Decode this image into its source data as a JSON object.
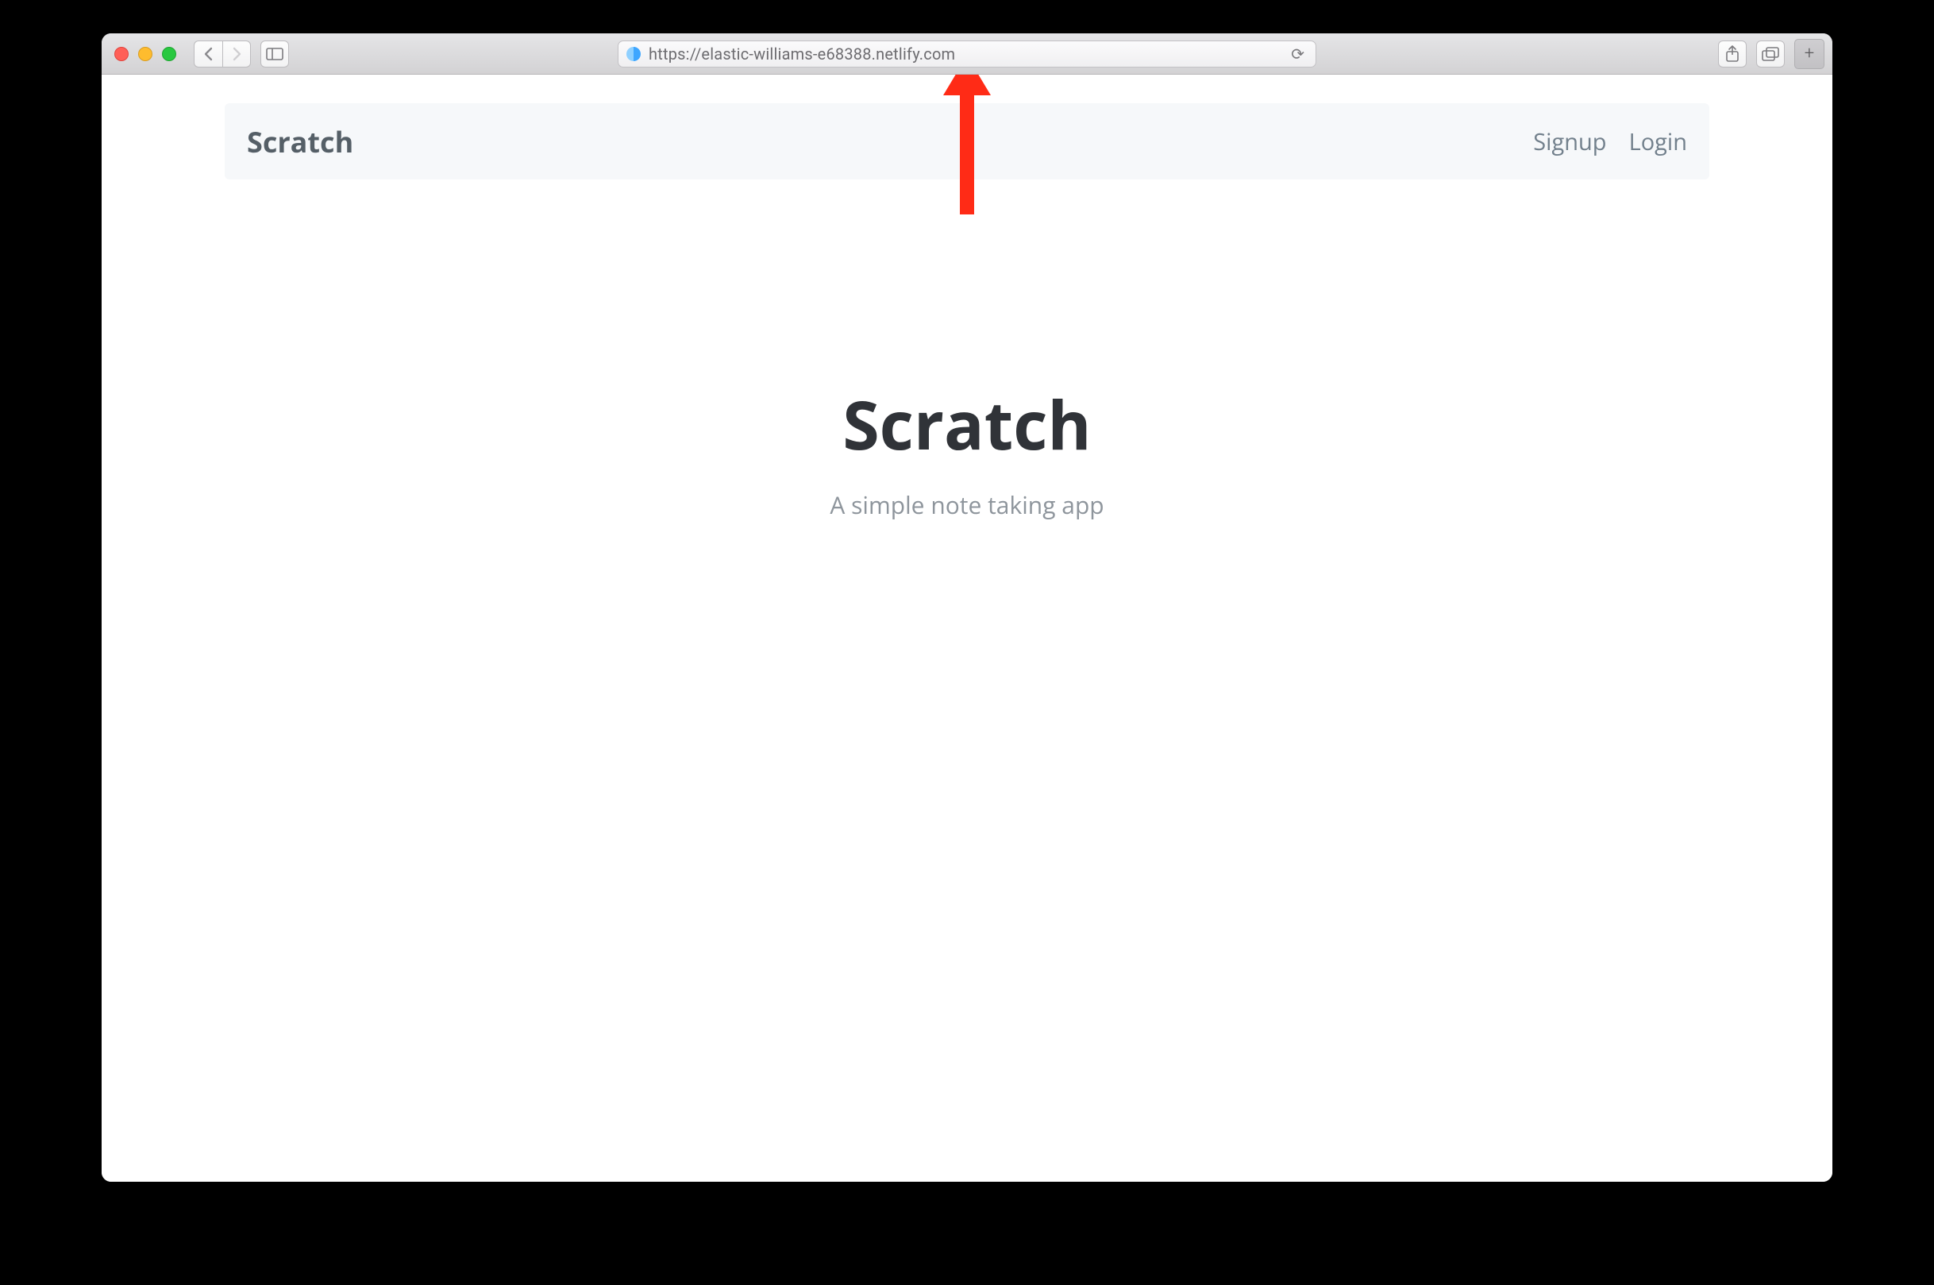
{
  "browser": {
    "url": "https://elastic-williams-e68388.netlify.com"
  },
  "annotation": {
    "color": "#ff2b16"
  },
  "app": {
    "navbar": {
      "brand": "Scratch",
      "links": [
        "Signup",
        "Login"
      ]
    },
    "hero": {
      "title": "Scratch",
      "subtitle": "A simple note taking app"
    }
  }
}
